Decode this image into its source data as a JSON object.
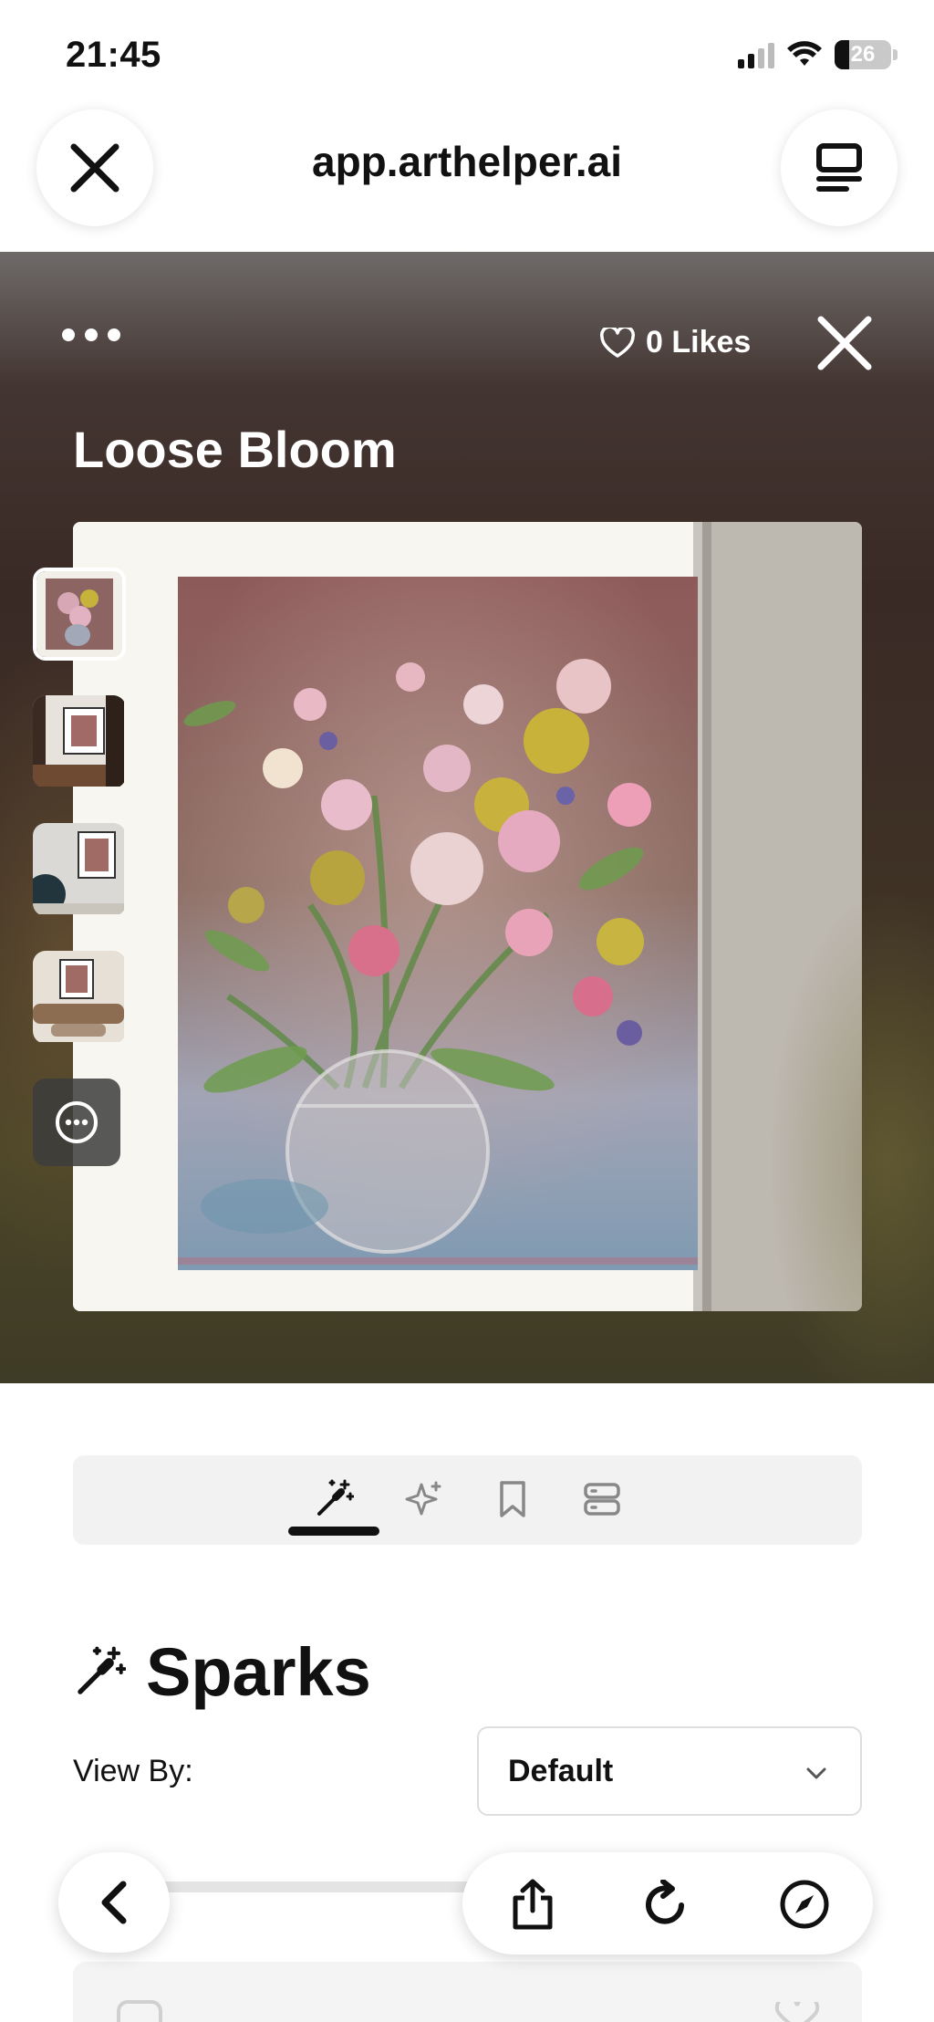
{
  "status_bar": {
    "time": "21:45",
    "battery": "26"
  },
  "browser": {
    "url": "app.arthelper.ai"
  },
  "artwork": {
    "title": "Loose Bloom",
    "likes_label": "0 Likes",
    "thumbnail_count": 4
  },
  "tabs": [
    {
      "icon": "magic-wand-icon",
      "active": true
    },
    {
      "icon": "sparkles-icon",
      "active": false
    },
    {
      "icon": "bookmark-icon",
      "active": false
    },
    {
      "icon": "server-icon",
      "active": false
    }
  ],
  "sparks": {
    "title": "Sparks",
    "view_by_label": "View By:",
    "view_by_value": "Default"
  },
  "colors": {
    "text": "#111111",
    "hero_bg": "#3a2a26",
    "tab_bg": "#f2f2f2"
  }
}
